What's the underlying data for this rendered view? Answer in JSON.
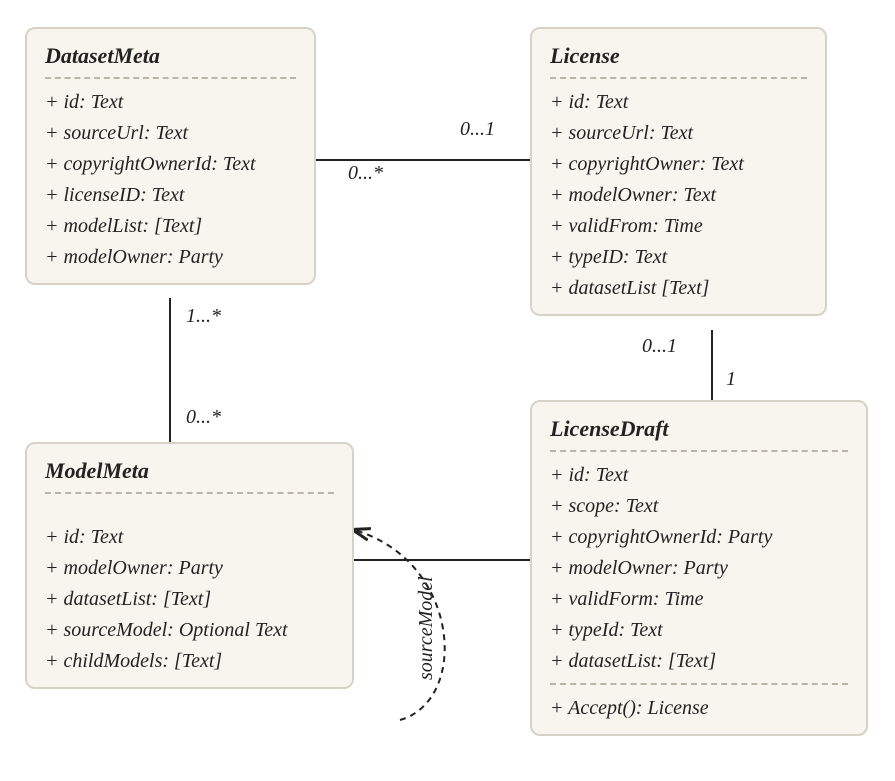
{
  "classes": {
    "datasetMeta": {
      "name": "DatasetMeta",
      "attrs": [
        "+ id: Text",
        "+ sourceUrl: Text",
        "+ copyrightOwnerId: Text",
        "+ licenseID: Text",
        "+ modelList: [Text]",
        "+ modelOwner: Party"
      ]
    },
    "license": {
      "name": "License",
      "attrs": [
        "+ id: Text",
        "+ sourceUrl: Text",
        "+ copyrightOwner: Text",
        "+ modelOwner: Text",
        "+ validFrom: Time",
        "+ typeID: Text",
        "+ datasetList [Text]"
      ]
    },
    "modelMeta": {
      "name": "ModelMeta",
      "attrs": [
        "+ id: Text",
        "+ modelOwner: Party",
        "+ datasetList: [Text]",
        "+ sourceModel: Optional Text",
        "+ childModels: [Text]"
      ]
    },
    "licenseDraft": {
      "name": "LicenseDraft",
      "attrs": [
        "+ id: Text",
        "+ scope: Text",
        "+ copyrightOwnerId: Party",
        "+ modelOwner: Party",
        "+ validForm: Time",
        "+ typeId: Text",
        "+ datasetList: [Text]"
      ],
      "ops": [
        "+ Accept(): License"
      ]
    }
  },
  "multiplicities": {
    "dm_lic_left": "0...*",
    "dm_lic_right": "0...1",
    "dm_mm_top": "1...*",
    "dm_mm_bottom": "0...*",
    "lic_ld_top": "0...1",
    "lic_ld_bottom": "1"
  },
  "relLabels": {
    "selfloop": "sourceModel"
  }
}
